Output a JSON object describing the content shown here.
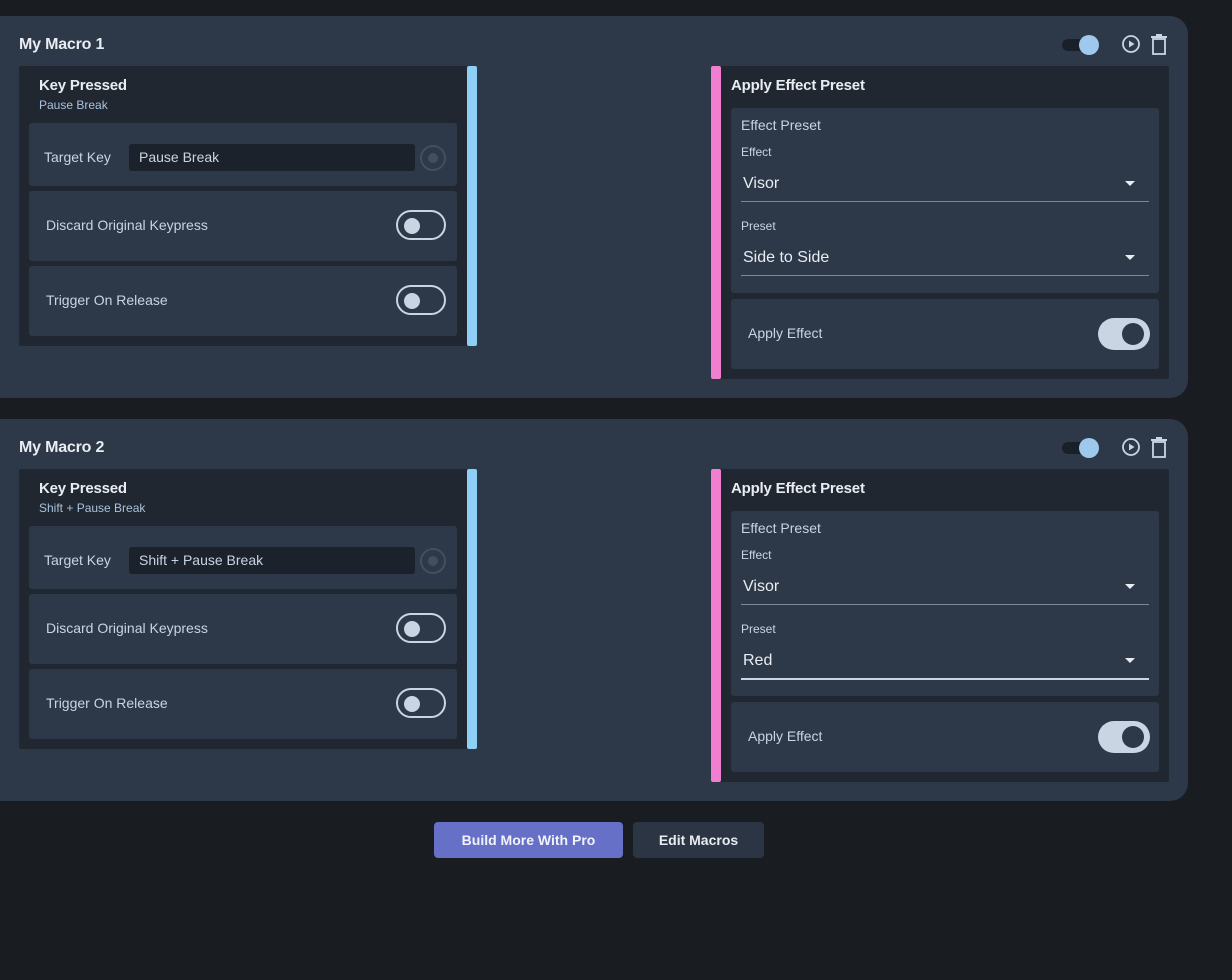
{
  "macros": [
    {
      "title": "My Macro 1",
      "enabled": true,
      "trigger": {
        "title": "Key Pressed",
        "subtitle": "Pause Break",
        "target_key_label": "Target Key",
        "target_key_value": "Pause Break",
        "discard_label": "Discard Original Keypress",
        "discard_on": false,
        "release_label": "Trigger On Release",
        "release_on": false
      },
      "action": {
        "title": "Apply Effect Preset",
        "preset_heading": "Effect Preset",
        "effect_label": "Effect",
        "effect_value": "Visor",
        "preset_label": "Preset",
        "preset_value": "Side to Side",
        "apply_label": "Apply Effect",
        "apply_on": true
      }
    },
    {
      "title": "My Macro 2",
      "enabled": true,
      "trigger": {
        "title": "Key Pressed",
        "subtitle": "Shift + Pause Break",
        "target_key_label": "Target Key",
        "target_key_value": "Shift + Pause Break",
        "discard_label": "Discard Original Keypress",
        "discard_on": false,
        "release_label": "Trigger On Release",
        "release_on": false
      },
      "action": {
        "title": "Apply Effect Preset",
        "preset_heading": "Effect Preset",
        "effect_label": "Effect",
        "effect_value": "Visor",
        "preset_label": "Preset",
        "preset_value": "Red",
        "apply_label": "Apply Effect",
        "apply_on": true
      }
    }
  ],
  "footer": {
    "pro_button_label": "Build More With Pro",
    "edit_button_label": "Edit Macros"
  },
  "colors": {
    "background": "#191c21",
    "card": "#2d3848",
    "panel": "#202731",
    "trigger_accent": "#8ecff7",
    "action_accent": "#f07fd0",
    "primary_button": "#6570c6"
  }
}
